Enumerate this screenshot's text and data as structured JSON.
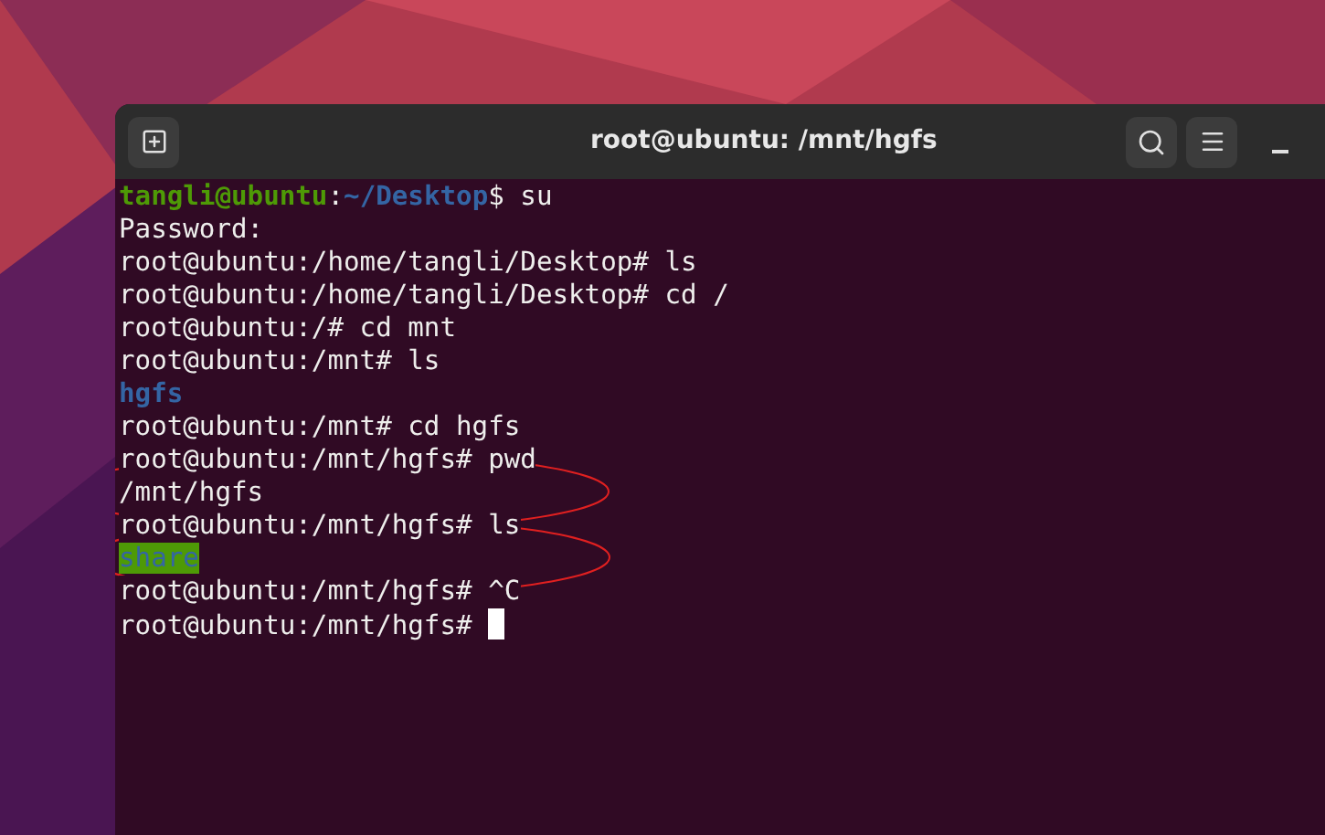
{
  "window": {
    "title": "root@ubuntu: /mnt/hgfs"
  },
  "terminal": {
    "lines": [
      [
        {
          "kind": "user",
          "text": "tangli@ubuntu"
        },
        {
          "kind": "plain",
          "text": ":"
        },
        {
          "kind": "path",
          "text": "~/Desktop"
        },
        {
          "kind": "plain",
          "text": "$ su"
        }
      ],
      [
        {
          "kind": "plain",
          "text": "Password:"
        }
      ],
      [
        {
          "kind": "plain",
          "text": "root@ubuntu:/home/tangli/Desktop# ls"
        }
      ],
      [
        {
          "kind": "plain",
          "text": "root@ubuntu:/home/tangli/Desktop# cd /"
        }
      ],
      [
        {
          "kind": "plain",
          "text": "root@ubuntu:/# cd mnt"
        }
      ],
      [
        {
          "kind": "plain",
          "text": "root@ubuntu:/mnt# ls"
        }
      ],
      [
        {
          "kind": "dir",
          "text": "hgfs"
        }
      ],
      [
        {
          "kind": "plain",
          "text": "root@ubuntu:/mnt# cd hgfs"
        }
      ],
      [
        {
          "kind": "plain",
          "text": "root@ubuntu:/mnt/hgfs# pwd"
        }
      ],
      [
        {
          "kind": "plain",
          "text": "/mnt/hgfs"
        }
      ],
      [
        {
          "kind": "plain",
          "text": "root@ubuntu:/mnt/hgfs# ls"
        }
      ],
      [
        {
          "kind": "shared_dir",
          "text": "share"
        }
      ],
      [
        {
          "kind": "plain",
          "text": "root@ubuntu:/mnt/hgfs# ^C"
        }
      ],
      [
        {
          "kind": "plain",
          "text": "root@ubuntu:/mnt/hgfs# "
        },
        {
          "kind": "cursor"
        }
      ]
    ]
  }
}
